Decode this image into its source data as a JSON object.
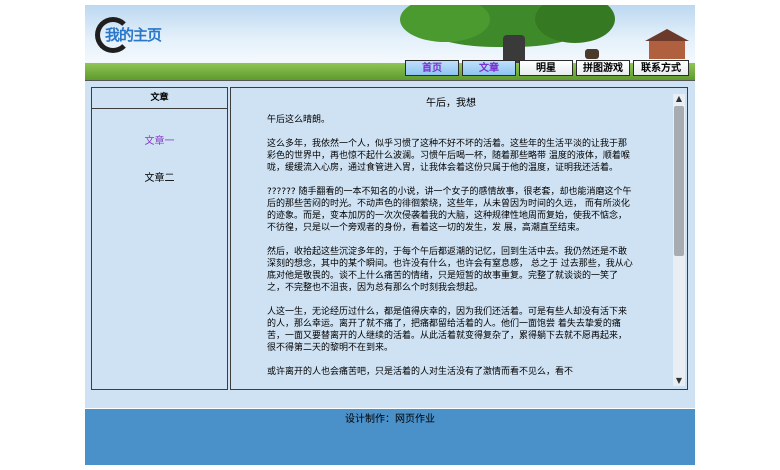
{
  "header": {
    "logo_text": "我的主页"
  },
  "nav": {
    "items": [
      {
        "label": "首页",
        "width": 54
      },
      {
        "label": "文章",
        "width": 54
      },
      {
        "label": "明星",
        "width": 54
      },
      {
        "label": "拼图游戏",
        "width": 54
      },
      {
        "label": "联系方式",
        "width": 56
      }
    ]
  },
  "sidebar": {
    "heading": "文章",
    "links": [
      "文章一",
      "文章二"
    ]
  },
  "article": {
    "title": "午后，我想",
    "paragraphs": [
      "午后这么晴朗。",
      "这么多年，我依然一个人，似乎习惯了这种不好不坏的活着。这些年的生活平淡的让我于那彩色的世界中，再也惊不起什么波澜。习惯午后喝一杯，随着那些略带 温度的液体，顺着喉咙，缓缓流入心房，通过食管进入胃，让我体会着这份只属于他的温度，证明我还活着。",
      "?????? 随手翻看的一本不知名的小说，讲一个女子的感情故事，很老套，却也能消磨这个午后的那些苦闷的时光。不动声色的徘徊萦绕，这些年，从未曾因为时间的久远， 而有所淡化的迹象。而是，变本加厉的一次次侵袭着我的大脑，这种规律性地周而复始，使我不惦念，不彷徨，只是以一个旁观者的身份，看着这一切的发生，发 展，高潮直至结束。",
      "然后，收拾起这些沉淀多年的，于每个午后都返潮的记忆，回到生活中去。我仍然还是不敢深刻的想念，其中的某个瞬间。也许没有什么，也许会有窒息感， 总之于 过去那些，我从心底对他是敬畏的。谈不上什么痛苦的情绪，只是短暂的故事重复。完整了就谈谈的一笑了之，不完整也不沮丧，因为总有那么个时刻我会想起。",
      "人这一生，无论经历过什么，都是值得庆幸的，因为我们还活着。可是有些人却没有活下来的人，那么幸运。离开了就不痛了，把痛都留给活着的人。他们一面饱尝 着失去挚爱的痛苦，一面又要替离开的人继续的活着。从此活着就变得复杂了，累得躺下去就不愿再起来，很不得第二天的黎明不在到来。",
      "或许离开的人也会痛苦吧，只是活着的人对生活没有了激情而看不见么，看不"
    ]
  },
  "footer": {
    "text": "设计制作：网页作业"
  }
}
